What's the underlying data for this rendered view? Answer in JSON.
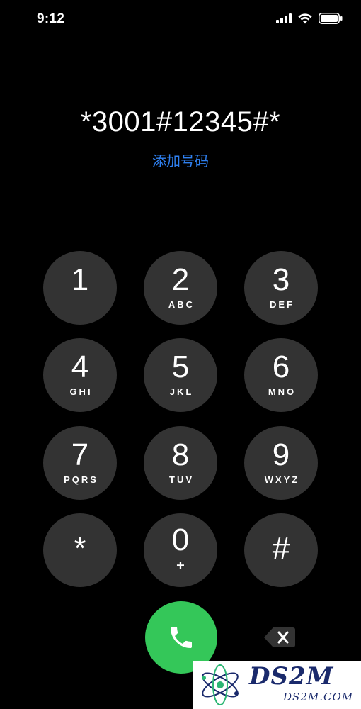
{
  "status_bar": {
    "time": "9:12",
    "icons": [
      "signal-icon",
      "wifi-icon",
      "battery-icon"
    ]
  },
  "dialer": {
    "number": "*3001#12345#*",
    "add_number_label": "添加号码",
    "keys": [
      {
        "digit": "1",
        "letters": ""
      },
      {
        "digit": "2",
        "letters": "ABC"
      },
      {
        "digit": "3",
        "letters": "DEF"
      },
      {
        "digit": "4",
        "letters": "GHI"
      },
      {
        "digit": "5",
        "letters": "JKL"
      },
      {
        "digit": "6",
        "letters": "MNO"
      },
      {
        "digit": "7",
        "letters": "PQRS"
      },
      {
        "digit": "8",
        "letters": "TUV"
      },
      {
        "digit": "9",
        "letters": "WXYZ"
      },
      {
        "digit": "*",
        "letters": ""
      },
      {
        "digit": "0",
        "letters": "+"
      },
      {
        "digit": "#",
        "letters": ""
      }
    ],
    "call_icon": "phone-icon",
    "delete_icon": "backspace-icon"
  },
  "colors": {
    "background": "#000000",
    "key": "#333333",
    "accent": "#2f80f0",
    "call": "#34c759"
  },
  "watermark": {
    "title": "DS2M",
    "subtitle": "DS2M.COM"
  }
}
